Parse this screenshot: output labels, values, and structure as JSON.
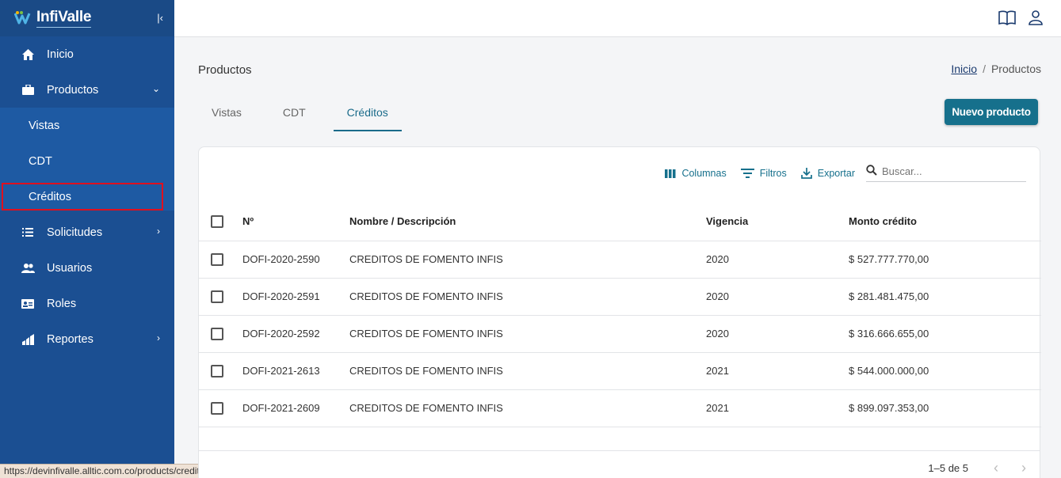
{
  "app": {
    "logo_text": "InfiValle",
    "status_url": "https://devinfivalle.alltic.com.co/products/credit"
  },
  "sidebar": {
    "items": [
      {
        "label": "Inicio",
        "icon": "home-icon"
      },
      {
        "label": "Productos",
        "icon": "briefcase-icon"
      },
      {
        "label": "Solicitudes",
        "icon": "list-icon"
      },
      {
        "label": "Usuarios",
        "icon": "users-icon"
      },
      {
        "label": "Roles",
        "icon": "id-card-icon"
      },
      {
        "label": "Reportes",
        "icon": "chart-icon"
      }
    ],
    "sub_items": [
      "Vistas",
      "CDT",
      "Créditos"
    ]
  },
  "header": {
    "page_title": "Productos",
    "breadcrumb": {
      "home": "Inicio",
      "sep": "/",
      "current": "Productos"
    }
  },
  "tabs": [
    "Vistas",
    "CDT",
    "Créditos"
  ],
  "new_button": "Nuevo producto",
  "toolbar": {
    "columns": "Columnas",
    "filters": "Filtros",
    "export": "Exportar",
    "search_placeholder": "Buscar..."
  },
  "table": {
    "headers": [
      "Nº",
      "Nombre / Descripción",
      "Vigencia",
      "Monto crédito"
    ],
    "rows": [
      [
        "DOFI-2020-2590",
        "CREDITOS DE FOMENTO INFIS",
        "2020",
        "$ 527.777.770,00"
      ],
      [
        "DOFI-2020-2591",
        "CREDITOS DE FOMENTO INFIS",
        "2020",
        "$ 281.481.475,00"
      ],
      [
        "DOFI-2020-2592",
        "CREDITOS DE FOMENTO INFIS",
        "2020",
        "$ 316.666.655,00"
      ],
      [
        "DOFI-2021-2613",
        "CREDITOS DE FOMENTO INFIS",
        "2021",
        "$ 544.000.000,00"
      ],
      [
        "DOFI-2021-2609",
        "CREDITOS DE FOMENTO INFIS",
        "2021",
        "$ 899.097.353,00"
      ]
    ]
  },
  "pagination": {
    "text": "1–5 de 5"
  },
  "colors": {
    "sidebar": "#1b4f92",
    "accent": "#16708c",
    "highlight": "#e0101e"
  }
}
